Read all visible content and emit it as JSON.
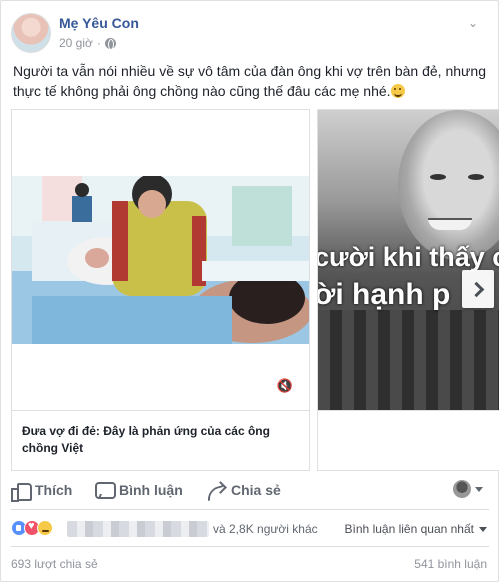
{
  "post": {
    "author": "Mẹ Yêu Con",
    "time": "20 giờ",
    "privacy_icon": "globe-icon",
    "text": "Người ta vẫn nói nhiều về sự vô tâm của đàn ông khi vợ trên bàn đẻ, nhưng thực tế không phải ông chồng nào cũng thế đâu các mẹ nhé."
  },
  "carousel": {
    "slides": [
      {
        "caption": "Đưa vợ đi đẻ: Đây là phản ứng của các ông chồng Việt"
      },
      {
        "overlay_line_1": "cười khi thấy co",
        "overlay_line_2": "ời hạnh p"
      }
    ]
  },
  "actions": {
    "like": "Thích",
    "comment": "Bình luận",
    "share": "Chia sẻ"
  },
  "reactions": {
    "others": "và 2,8K người khác",
    "filter": "Bình luận liên quan nhất"
  },
  "counts": {
    "shares": "693 lượt chia sẻ",
    "comments": "541 bình luận"
  }
}
